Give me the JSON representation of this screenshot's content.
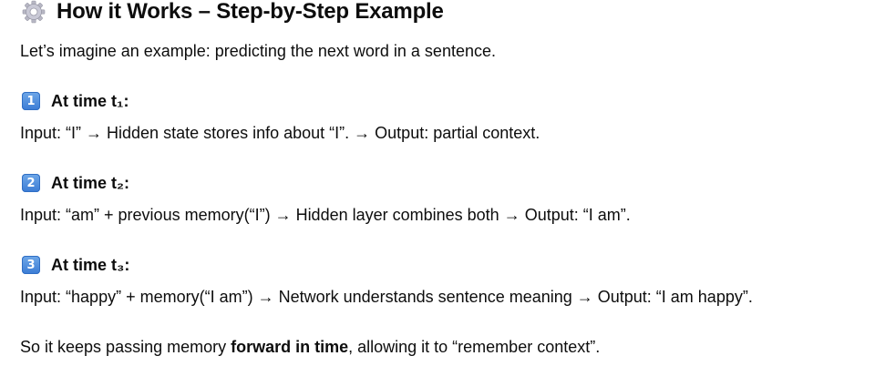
{
  "heading": {
    "icon": "gear-icon",
    "title": "How it Works – Step-by-Step Example"
  },
  "intro": "Let’s imagine an example: predicting the next word in a sentence.",
  "steps": [
    {
      "number": "1",
      "title": "At time t₁:",
      "text": "Input: “I” → Hidden state stores info about “I”. → Output: partial context."
    },
    {
      "number": "2",
      "title": "At time t₂:",
      "text": "Input: “am” + previous memory(“I”) → Hidden layer combines both → Output: “I am”."
    },
    {
      "number": "3",
      "title": "At time t₃:",
      "text": "Input: “happy” + memory(“I am”) → Network understands sentence meaning → Output: “I am happy”."
    }
  ],
  "summary": {
    "before": "So it keeps passing memory ",
    "bold": "forward in time",
    "after": ", allowing it to “remember context”."
  },
  "colors": {
    "text": "#0d0d0d",
    "keycap": "#3a7bd5"
  }
}
